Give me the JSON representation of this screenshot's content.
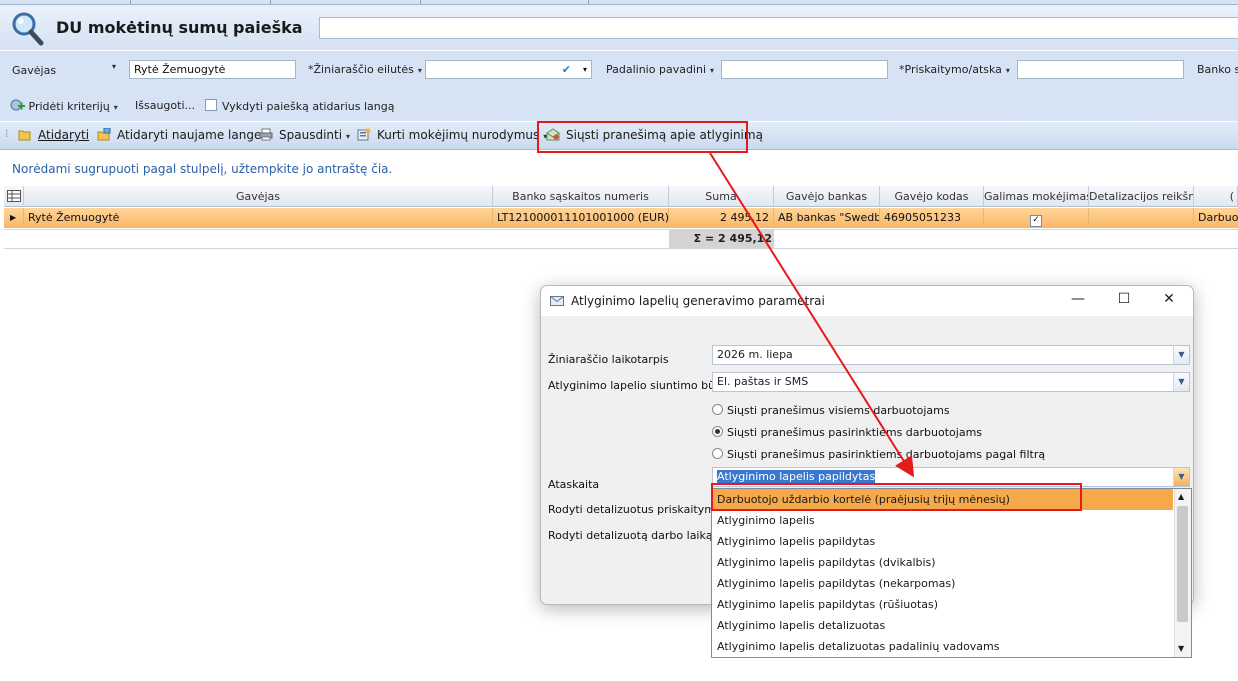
{
  "header": {
    "title": "DU mokėtinų sumų paieška",
    "search_value": ""
  },
  "criteria": {
    "gavejas_label": "Gavėjas",
    "gavejas_value": "Rytė Žemuogytė",
    "ziniarastis_label": "*Žiniaraščio eilutės",
    "padalinio_label": "Padalinio pavadini",
    "priskaitymo_label": "*Priskaitymo/atska",
    "banko_label": "Banko sa",
    "prideti_label": "Pridėti kriterijų",
    "issaugoti_label": "Išsaugoti...",
    "vykdyti_label": "Vykdyti paiešką atidarius langą"
  },
  "toolbar": {
    "atidaryti": "Atidaryti",
    "atidaryti_naujame": "Atidaryti naujame lange",
    "spausdinti": "Spausdinti",
    "kurti": "Kurti mokėjimų nurodymus",
    "siusti": "Siųsti pranešimą apie atlyginimą"
  },
  "group_hint": "Norėdami sugrupuoti pagal stulpelį, užtempkite jo antraštę čia.",
  "grid": {
    "columns": [
      "Gavėjas",
      "Banko sąskaitos numeris",
      "Suma",
      "Gavėjo bankas",
      "Gavėjo kodas",
      "Galimas mokėjimas",
      "Detalizacijos reikšm",
      "("
    ],
    "row": {
      "gavejas": "Rytė Žemuogytė",
      "saskaita": "LT121000011101001000 (EUR)",
      "suma": "2 495,12",
      "bankas": "AB bankas \"Swedb",
      "kodas": "46905051233",
      "galimas": true,
      "detalizacija": "",
      "extra": "Darbuo"
    },
    "sum_text": "Σ = 2 495,12"
  },
  "dialog": {
    "title": "Atlyginimo lapelių generavimo parametrai",
    "laikotarpis_label": "Žiniaraščio laikotarpis",
    "laikotarpis_value": "2026 m. liepa",
    "budas_label": "Atlyginimo lapelio siuntimo būdas",
    "budas_value": "El. paštas ir SMS",
    "radio_all": "Siųsti pranešimus visiems darbuotojams",
    "radio_selected": "Siųsti pranešimus pasirinktiems darbuotojams",
    "radio_filter": "Siųsti pranešimus pasirinktiems darbuotojams pagal filtrą",
    "ataskaita_label": "Ataskaita",
    "ataskaita_value": "Atlyginimo lapelis papildytas",
    "rodyti_prisk_label": "Rodyti detalizuotus priskaitymus",
    "rodyti_laika_label": "Rodyti detalizuotą darbo laiką"
  },
  "dropdown_options": [
    "Darbuotojo uždarbio kortelė (praėjusių trijų mėnesių)",
    "Atlyginimo lapelis",
    "Atlyginimo lapelis papildytas",
    "Atlyginimo lapelis papildytas (dvikalbis)",
    "Atlyginimo lapelis papildytas (nekarpomas)",
    "Atlyginimo lapelis papildytas (rūšiuotas)",
    "Atlyginimo lapelis detalizuotas",
    "Atlyginimo lapelis detalizuotas padalinių vadovams"
  ],
  "colors": {
    "accent_orange": "#f5a94a",
    "annotation_red": "#e41b1b",
    "hint_blue": "#2a5fa8"
  }
}
